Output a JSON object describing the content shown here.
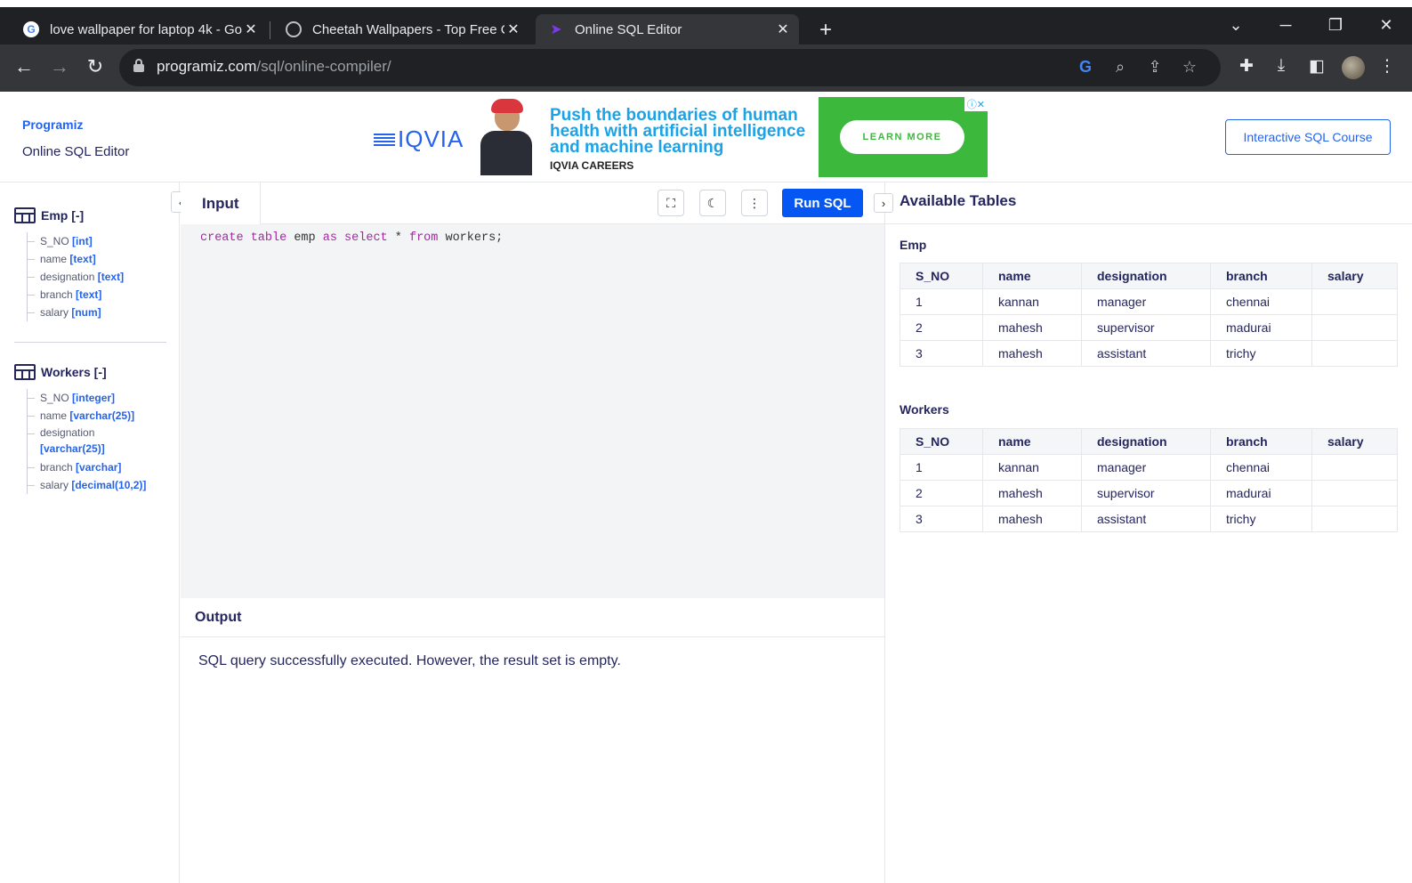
{
  "browser": {
    "tabs": [
      {
        "title": "love wallpaper for laptop 4k - Go",
        "icon": "google-icon"
      },
      {
        "title": "Cheetah Wallpapers - Top Free C",
        "icon": "globe-icon"
      },
      {
        "title": "Online SQL Editor",
        "icon": "programiz-icon"
      }
    ],
    "url_host": "programiz.com",
    "url_path": "/sql/online-compiler/"
  },
  "header": {
    "logo": "Programiz",
    "subtitle": "Online SQL Editor",
    "course_button": "Interactive SQL Course"
  },
  "ad": {
    "brand": "IQVIA",
    "headline": "Push the boundaries of human health with artificial intelligence and machine learning",
    "sub": "IQVIA CAREERS",
    "cta": "LEARN MORE"
  },
  "schema": [
    {
      "name": "Emp [-]",
      "columns": [
        {
          "name": "S_NO",
          "type": "[int]"
        },
        {
          "name": "name",
          "type": "[text]"
        },
        {
          "name": "designation",
          "type": "[text]"
        },
        {
          "name": "branch",
          "type": "[text]"
        },
        {
          "name": "salary",
          "type": "[num]"
        }
      ]
    },
    {
      "name": "Workers [-]",
      "columns": [
        {
          "name": "S_NO",
          "type": "[integer]"
        },
        {
          "name": "name",
          "type": "[varchar(25)]"
        },
        {
          "name": "designation",
          "type": "[varchar(25)]"
        },
        {
          "name": "branch",
          "type": "[varchar]"
        },
        {
          "name": "salary",
          "type": "[decimal(10,2)]"
        }
      ]
    }
  ],
  "editor": {
    "tab_label": "Input",
    "run_label": "Run SQL",
    "code_tokens": [
      {
        "t": "create table",
        "kw": true
      },
      {
        "t": " emp ",
        "kw": false
      },
      {
        "t": "as select",
        "kw": true
      },
      {
        "t": " * ",
        "kw": false
      },
      {
        "t": "from",
        "kw": true
      },
      {
        "t": " workers;",
        "kw": false
      }
    ]
  },
  "output": {
    "label": "Output",
    "message": "SQL query successfully executed. However, the result set is empty."
  },
  "tables_panel": {
    "title": "Available Tables",
    "tables": [
      {
        "name": "Emp",
        "headers": [
          "S_NO",
          "name",
          "designation",
          "branch",
          "salary"
        ],
        "rows": [
          [
            "1",
            "kannan",
            "manager",
            "chennai",
            ""
          ],
          [
            "2",
            "mahesh",
            "supervisor",
            "madurai",
            ""
          ],
          [
            "3",
            "mahesh",
            "assistant",
            "trichy",
            ""
          ]
        ]
      },
      {
        "name": "Workers",
        "headers": [
          "S_NO",
          "name",
          "designation",
          "branch",
          "salary"
        ],
        "rows": [
          [
            "1",
            "kannan",
            "manager",
            "chennai",
            ""
          ],
          [
            "2",
            "mahesh",
            "supervisor",
            "madurai",
            ""
          ],
          [
            "3",
            "mahesh",
            "assistant",
            "trichy",
            ""
          ]
        ]
      }
    ]
  }
}
